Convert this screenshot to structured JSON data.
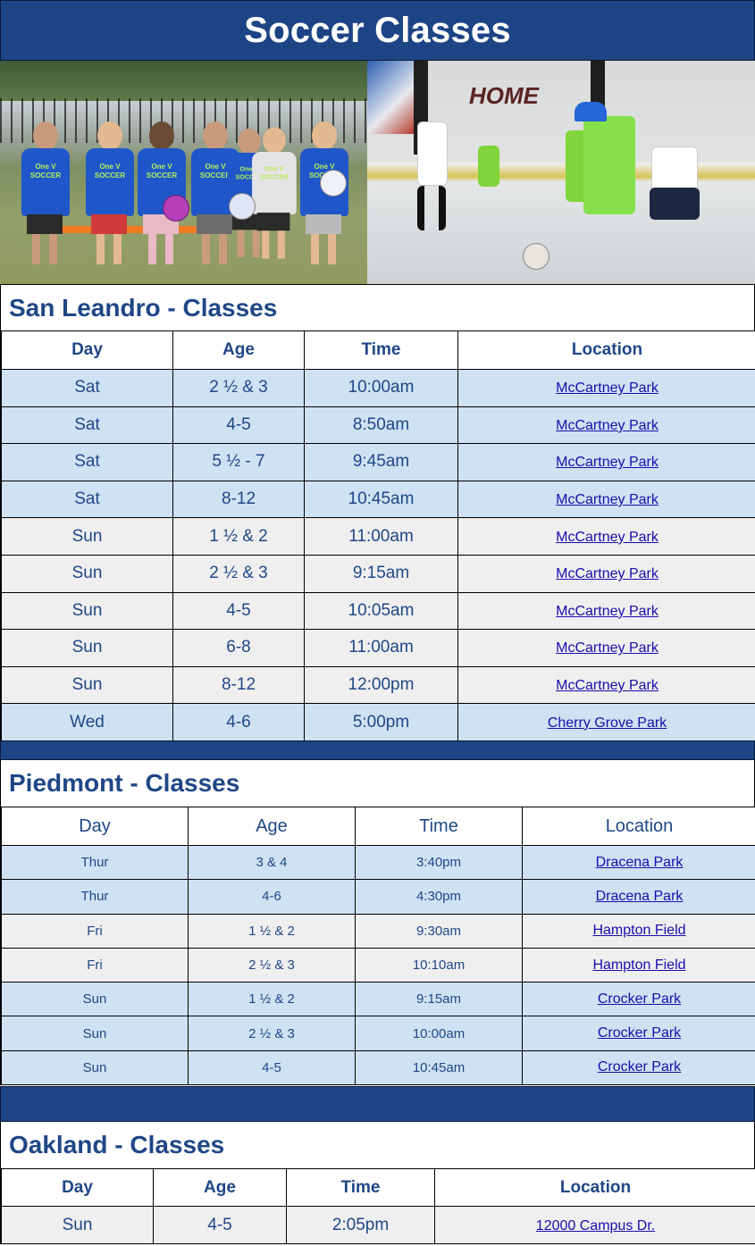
{
  "header": {
    "title": "Soccer Classes"
  },
  "photos": {
    "left_alt": "Toddlers in blue One V Soccer shirts holding soccer balls on a grass field",
    "right_alt": "Kids playing indoor soccer in a rink with HOME sign",
    "right_sign": "HOME"
  },
  "columns": {
    "day": "Day",
    "age": "Age",
    "time": "Time",
    "location": "Location"
  },
  "san_leandro": {
    "title": "San Leandro - Classes",
    "rows": [
      {
        "day": "Sat",
        "age": "2 ½ & 3",
        "time": "10:00am",
        "location": "McCartney Park",
        "shade": "blue"
      },
      {
        "day": "Sat",
        "age": "4-5",
        "time": "8:50am",
        "location": "McCartney Park",
        "shade": "blue"
      },
      {
        "day": "Sat",
        "age": "5 ½ - 7",
        "time": "9:45am",
        "location": "McCartney Park",
        "shade": "blue"
      },
      {
        "day": "Sat",
        "age": "8-12",
        "time": "10:45am",
        "location": "McCartney Park",
        "shade": "blue"
      },
      {
        "day": "Sun",
        "age": "1 ½ & 2",
        "time": "11:00am",
        "location": "McCartney Park",
        "shade": "gray"
      },
      {
        "day": "Sun",
        "age": "2 ½ & 3",
        "time": "9:15am",
        "location": "McCartney Park",
        "shade": "gray"
      },
      {
        "day": "Sun",
        "age": "4-5",
        "time": "10:05am",
        "location": "McCartney Park",
        "shade": "gray"
      },
      {
        "day": "Sun",
        "age": "6-8",
        "time": "11:00am",
        "location": "McCartney Park",
        "shade": "gray"
      },
      {
        "day": "Sun",
        "age": "8-12",
        "time": "12:00pm",
        "location": "McCartney Park",
        "shade": "gray"
      },
      {
        "day": "Wed",
        "age": "4-6",
        "time": "5:00pm",
        "location": "Cherry Grove Park",
        "shade": "blue"
      }
    ]
  },
  "piedmont": {
    "title": "Piedmont - Classes",
    "rows": [
      {
        "day": "Thur",
        "age": "3 & 4",
        "time": "3:40pm",
        "location": "Dracena Park",
        "shade": "blue"
      },
      {
        "day": "Thur",
        "age": "4-6",
        "time": "4:30pm",
        "location": "Dracena Park",
        "shade": "blue"
      },
      {
        "day": "Fri",
        "age": "1 ½ & 2",
        "time": "9:30am",
        "location": "Hampton Field",
        "shade": "gray"
      },
      {
        "day": "Fri",
        "age": "2 ½ & 3",
        "time": "10:10am",
        "location": "Hampton Field",
        "shade": "gray"
      },
      {
        "day": "Sun",
        "age": "1 ½ & 2",
        "time": "9:15am",
        "location": "Crocker Park",
        "shade": "blue"
      },
      {
        "day": "Sun",
        "age": "2 ½ & 3",
        "time": "10:00am",
        "location": "Crocker Park",
        "shade": "blue"
      },
      {
        "day": "Sun",
        "age": "4-5",
        "time": "10:45am",
        "location": "Crocker Park",
        "shade": "blue"
      }
    ]
  },
  "oakland": {
    "title": "Oakland - Classes",
    "rows": [
      {
        "day": "Sun",
        "age": "4-5",
        "time": "2:05pm",
        "location": "12000 Campus Dr.",
        "shade": "gray"
      }
    ]
  },
  "colors": {
    "brand_navy": "#1d4586",
    "heading_text": "#1f4786",
    "row_blue": "#cfe2f3",
    "row_gray": "#efefef",
    "link": "#1a0dab"
  }
}
